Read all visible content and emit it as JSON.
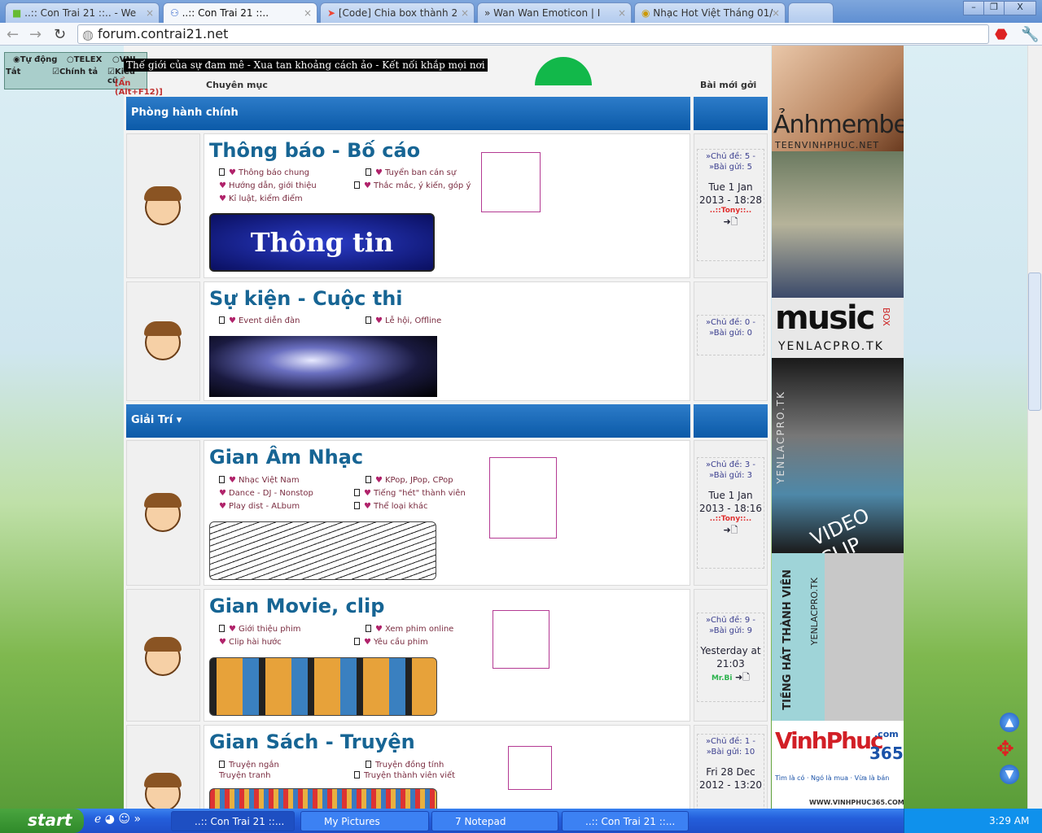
{
  "browser": {
    "tabs": [
      {
        "title": "..:: Con Trai 21 ::.. - We",
        "active": false
      },
      {
        "title": "..:: Con Trai 21 ::..",
        "active": true
      },
      {
        "title": "[Code] Chia box thành 2",
        "active": false
      },
      {
        "title": "» Wan Wan Emoticon | I",
        "active": false
      },
      {
        "title": "Nhạc Hot Việt Tháng 01/",
        "active": false
      }
    ],
    "url": "forum.contrai21.net",
    "window_controls": {
      "minimize": "–",
      "restore": "❐",
      "close": "X"
    }
  },
  "vietkey": {
    "options": [
      "Tự động",
      "TELEX",
      "VNI"
    ],
    "selected": "Tự động",
    "off": "Tắt",
    "spell": "Chính tả",
    "old_style": "Kiểu cũ",
    "hide": "[Ẩn (Alt+F12)]"
  },
  "slogan": "Thế giới của sự đam mê - Xua tan khoảng cách ảo - Kết nối khắp mọi nơi",
  "headers": {
    "forum": "Chuyên mục",
    "last_post": "Bài mới gởi"
  },
  "categories": [
    {
      "title": "Phòng hành chính"
    },
    {
      "title": "Giải Trí ▾"
    }
  ],
  "forums": [
    {
      "title": "Thông báo - Bố cáo",
      "subs_left": [
        "Thông báo chung",
        "Hướng dẫn, giới thiệu",
        "Kỉ luật, kiểm điểm"
      ],
      "subs_right": [
        "Tuyển ban cán sự",
        "Thắc mắc, ý kiến, góp ý"
      ],
      "banner": "Thông tin",
      "topics_label": "»Chủ đề: 5 - »Bài gửi: 5",
      "date": "Tue 1 Jan 2013 - 18:28",
      "user": "..::Tony::..",
      "user_color": "#e0302f"
    },
    {
      "title": "Sự kiện - Cuộc thi",
      "subs_left": [
        "Event diễn đàn"
      ],
      "subs_right": [
        "Lễ hội, Offline"
      ],
      "topics_label": "»Chủ đề: 0 - »Bài gửi: 0"
    },
    {
      "title": "Gian Âm Nhạc",
      "subs_left": [
        "Nhạc Việt Nam",
        "Dance - DJ - Nonstop",
        "Play dist - ALbum"
      ],
      "subs_right": [
        "KPop, JPop, CPop",
        "Tiếng \"hét\" thành viên",
        "Thể loại khác"
      ],
      "topics_label": "»Chủ đề: 3 - »Bài gửi: 3",
      "date": "Tue 1 Jan 2013 - 18:16",
      "user": "..::Tony::..",
      "user_color": "#e0302f"
    },
    {
      "title": "Gian Movie, clip",
      "subs_left": [
        "Giới thiệu phim",
        "Clip hài hước"
      ],
      "subs_right": [
        "Xem phim online",
        "Yêu cầu phim"
      ],
      "topics_label": "»Chủ đề: 9 - »Bài gửi: 9",
      "date": "Yesterday at 21:03",
      "user": "Mr.Bi",
      "user_color": "#2bb24c"
    },
    {
      "title": "Gian Sách - Truyện",
      "subs_left": [
        "Truyện ngắn",
        "Truyện tranh"
      ],
      "subs_right": [
        "Truyện đồng tính",
        "Truyện thành viên viết"
      ],
      "topics_label": "»Chủ đề: 1 - »Bài gửi: 10",
      "date": "Fri 28 Dec 2012 - 13:20"
    }
  ],
  "ads": {
    "a1_title": "Ảnhmember",
    "a1_sub": "TEENVINHPHUC.NET",
    "a2_title": "music",
    "a2_box": "BOX",
    "a2_sub": "YENLACPRO.TK",
    "a3_side": "YENLACPRO.TK",
    "a3_clip": "VIDEO CLIP",
    "a4_title": "TIẾNG HÁT THÀNH VIÊN",
    "a4_sub": "YENLACPRO.TK",
    "a5_title": "VinhPhuc",
    "a5_com": ".com",
    "a5_num": "365",
    "a5_tag": "Tìm là có · Ngó là mua · Vừa là bán",
    "a5_url": "WWW.VINHPHUC365.COM"
  },
  "taskbar": {
    "start": "start",
    "tasks": [
      "..:: Con Trai 21 ::...",
      "My Pictures",
      "7 Notepad",
      "..:: Con Trai 21 ::..."
    ],
    "clock": "3:29 AM"
  }
}
